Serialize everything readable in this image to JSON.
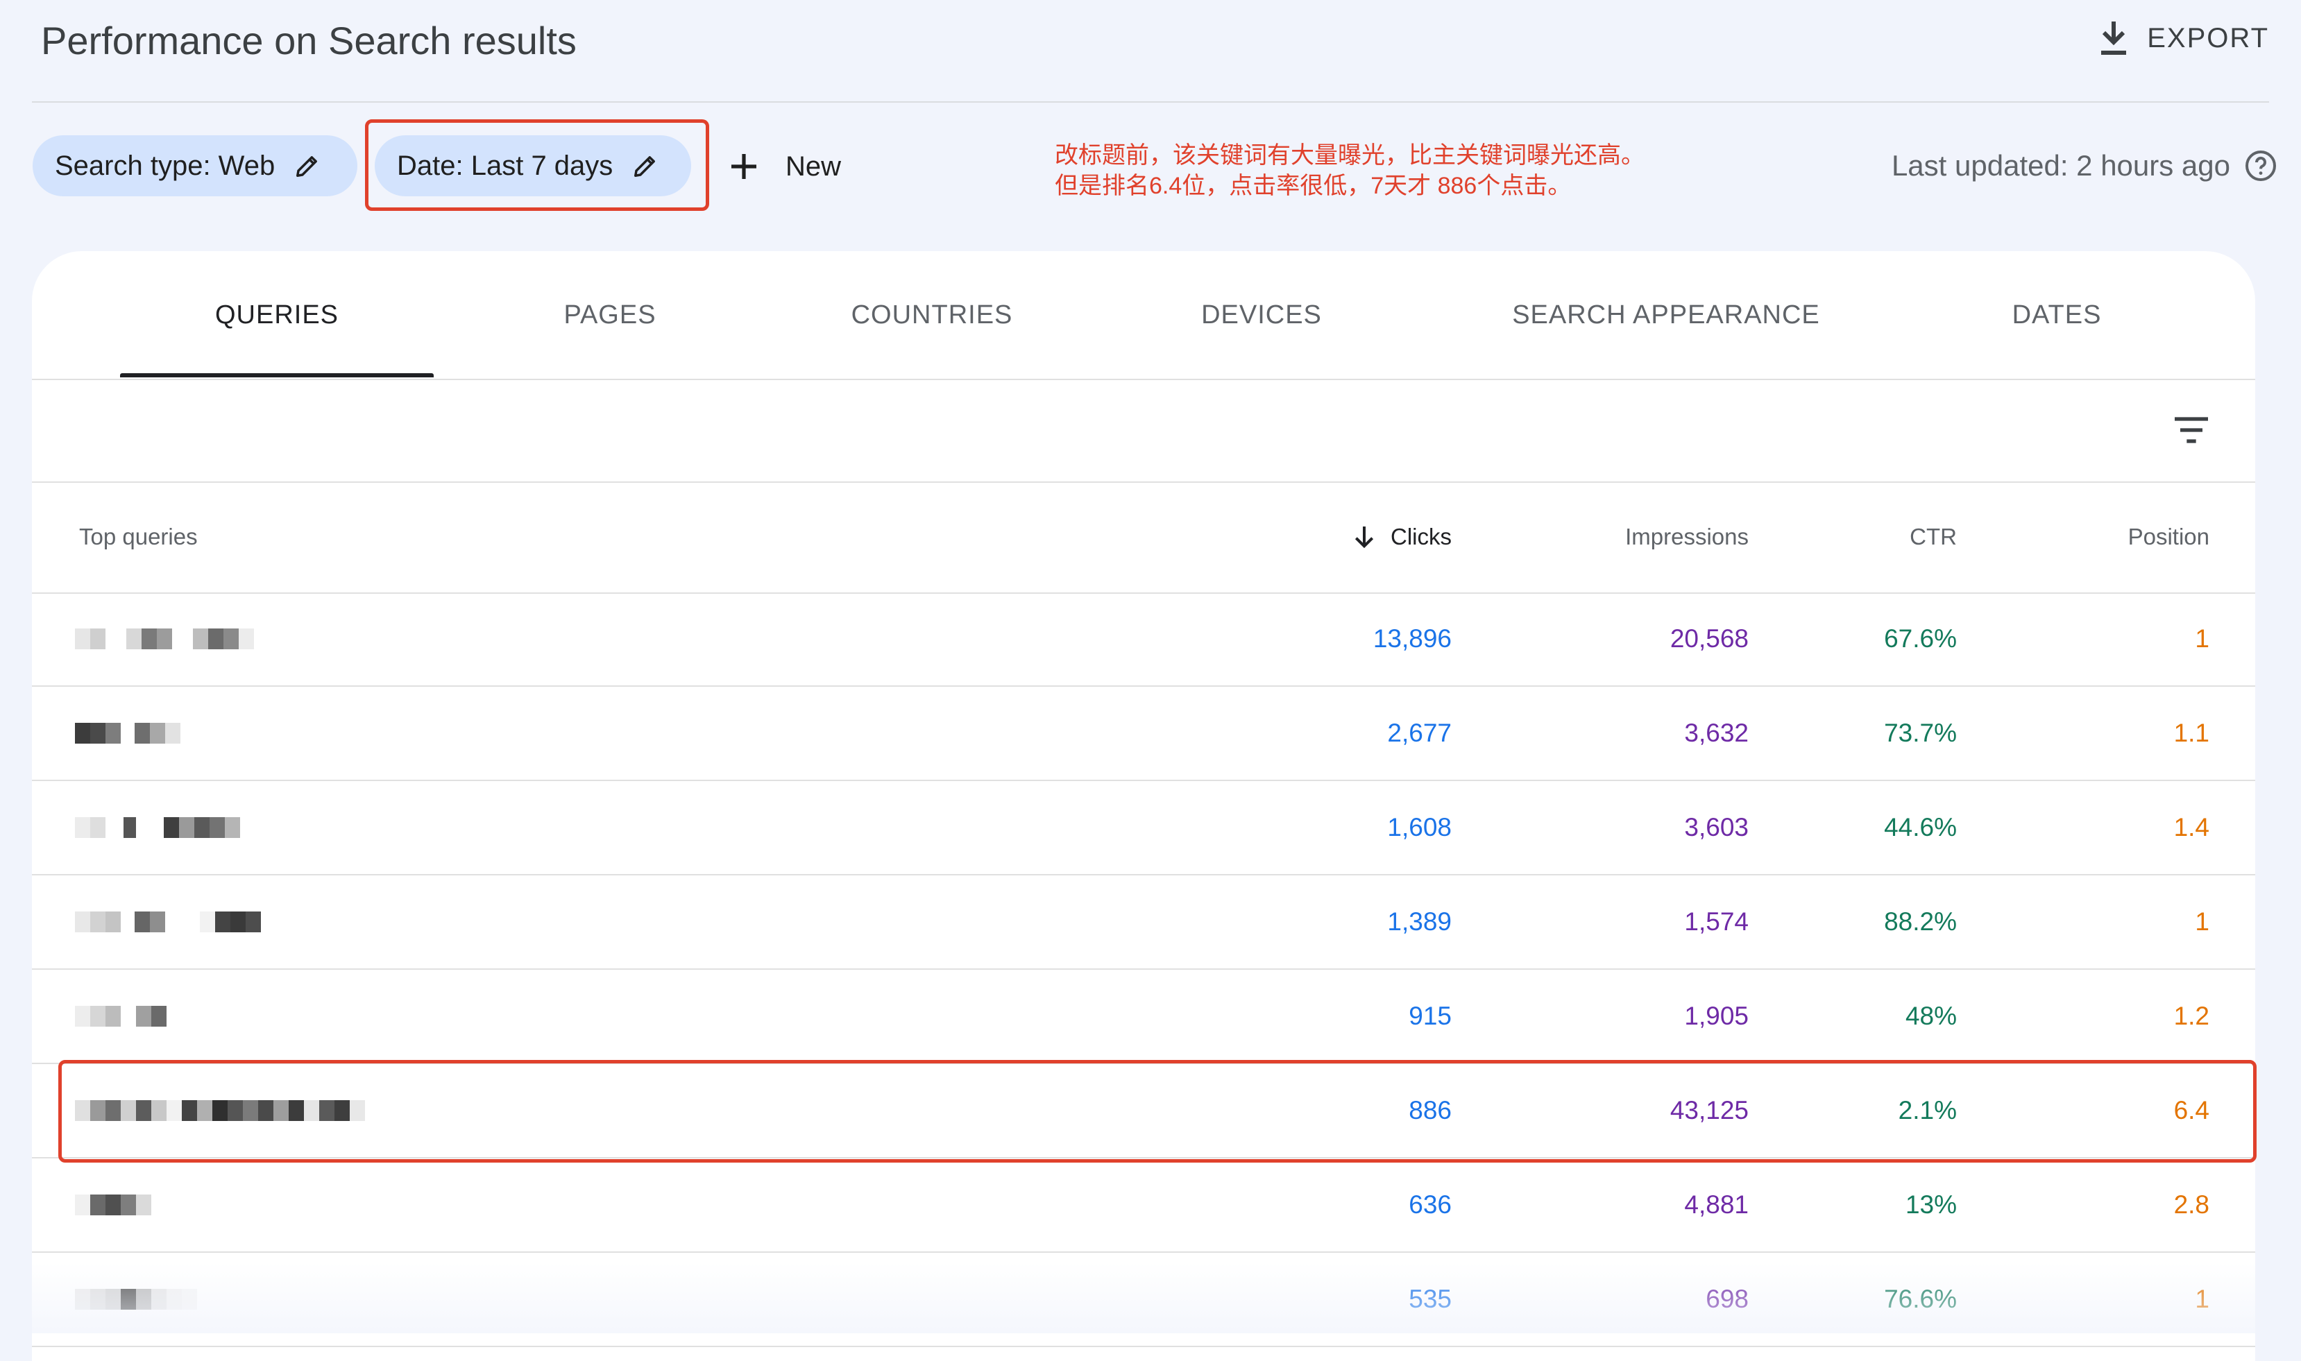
{
  "header": {
    "title": "Performance on Search results",
    "export_label": "EXPORT",
    "export_icon": "download-icon"
  },
  "filters": {
    "search_type_label": "Search type: Web",
    "date_label": "Date: Last 7 days",
    "new_label": "New",
    "last_updated": "Last updated: 2 hours ago"
  },
  "annotation": {
    "line1": "改标题前，该关键词有大量曝光，比主关键词曝光还高。",
    "line2": "但是排名6.4位，点击率很低，7天才 886个点击。",
    "color": "#e0412c"
  },
  "tabs": [
    {
      "label": "QUERIES",
      "active": true
    },
    {
      "label": "PAGES"
    },
    {
      "label": "COUNTRIES"
    },
    {
      "label": "DEVICES"
    },
    {
      "label": "SEARCH APPEARANCE"
    },
    {
      "label": "DATES"
    }
  ],
  "table": {
    "headers": {
      "query": "Top queries",
      "clicks": "Clicks",
      "impressions": "Impressions",
      "ctr": "CTR",
      "position": "Position"
    },
    "sort": "clicks-descending",
    "rows": [
      {
        "clicks": "13,896",
        "impressions": "20,568",
        "ctr": "67.6%",
        "position": "1"
      },
      {
        "clicks": "2,677",
        "impressions": "3,632",
        "ctr": "73.7%",
        "position": "1.1"
      },
      {
        "clicks": "1,608",
        "impressions": "3,603",
        "ctr": "44.6%",
        "position": "1.4"
      },
      {
        "clicks": "1,389",
        "impressions": "1,574",
        "ctr": "88.2%",
        "position": "1"
      },
      {
        "clicks": "915",
        "impressions": "1,905",
        "ctr": "48%",
        "position": "1.2"
      },
      {
        "clicks": "886",
        "impressions": "43,125",
        "ctr": "2.1%",
        "position": "6.4",
        "highlighted": true
      },
      {
        "clicks": "636",
        "impressions": "4,881",
        "ctr": "13%",
        "position": "2.8"
      },
      {
        "clicks": "535",
        "impressions": "698",
        "ctr": "76.6%",
        "position": "1"
      }
    ]
  },
  "colors": {
    "clicks": "#1a73e8",
    "impressions": "#6e2aa6",
    "ctr": "#137a5b",
    "position": "#e37400",
    "chip_bg": "#d3e3fd"
  }
}
